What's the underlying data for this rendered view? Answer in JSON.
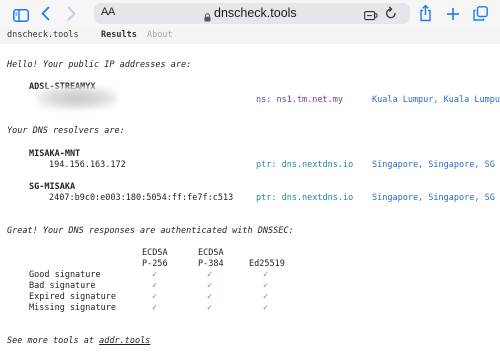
{
  "browser": {
    "aa_label": "AA",
    "url": "dnscheck.tools",
    "icons": [
      "sidebar-icon",
      "back-icon",
      "forward-icon",
      "lock-icon",
      "extension-icon",
      "reload-icon",
      "share-icon",
      "new-tab-icon",
      "tabs-icon"
    ],
    "accent": "#1a7cf5"
  },
  "nav": {
    "brand": "dnscheck.tools",
    "results": "Results",
    "about": "About"
  },
  "intro": "Hello! Your public IP addresses are:",
  "public_ip": {
    "name": "ADSL-STREAMYX",
    "ns": "ns: ns1.tm.net.my",
    "location": "Kuala Lumpur, Kuala Lumpu"
  },
  "resolvers_heading": "Your DNS resolvers are:",
  "resolvers": [
    {
      "name": "MISAKA-MNT",
      "ip": "194.156.163.172",
      "ptr": "ptr: dns.nextdns.io",
      "location": "Singapore, Singapore, SG"
    },
    {
      "name": "SG-MISAKA",
      "ip": "2407:b9c0:e003:180:5054:ff:fe7f:c513",
      "ptr": "ptr: dns.nextdns.io",
      "location": "Singapore, Singapore, SG"
    }
  ],
  "dnssec_heading": "Great! Your DNS responses are authenticated with DNSSEC:",
  "dnssec": {
    "columns": [
      {
        "line1": "ECDSA",
        "line2": "P-256"
      },
      {
        "line1": "ECDSA",
        "line2": "P-384"
      },
      {
        "line1": "",
        "line2": "Ed25519"
      }
    ],
    "rows": [
      {
        "label": "Good signature",
        "marks": [
          "✓",
          "✓",
          "✓"
        ]
      },
      {
        "label": "Bad signature",
        "marks": [
          "✓",
          "✓",
          "✓"
        ]
      },
      {
        "label": "Expired signature",
        "marks": [
          "✓",
          "✓",
          "✓"
        ]
      },
      {
        "label": "Missing signature",
        "marks": [
          "✓",
          "✓",
          "✓"
        ]
      }
    ]
  },
  "footer": {
    "prefix": "See more tools at ",
    "link": "addr.tools"
  }
}
